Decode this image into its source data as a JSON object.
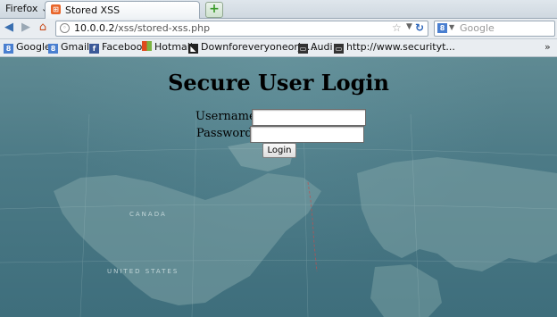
{
  "browser": {
    "menu_label": "Firefox",
    "tab_title": "Stored XSS",
    "new_tab_label": "+"
  },
  "nav": {
    "url_host": "10.0.0.2",
    "url_path": "/xss/stored-xss.php",
    "search_placeholder": "Google"
  },
  "bookmarks": [
    {
      "label": "Google",
      "icon": "google-icon",
      "color": "#4a7fd0"
    },
    {
      "label": "Gmail",
      "icon": "gmail-icon",
      "color": "#4a7fd0"
    },
    {
      "label": "Facebook",
      "icon": "facebook-icon",
      "color": "#3b5998"
    },
    {
      "label": "Hotmail",
      "icon": "windows-icon",
      "color": "#e04a1e"
    },
    {
      "label": "Downforeveryoneorju...",
      "icon": "downforeveryone-icon",
      "color": "#222222"
    },
    {
      "label": "Audi",
      "icon": "folder-icon",
      "color": "#333333"
    },
    {
      "label": "http://www.securityt...",
      "icon": "folder-icon",
      "color": "#333333"
    }
  ],
  "page": {
    "title": "Secure User Login",
    "username_label": "Username:",
    "password_label": "Password:",
    "login_button": "Login"
  },
  "map_labels": [
    "CANADA",
    "UNITED STATES"
  ]
}
